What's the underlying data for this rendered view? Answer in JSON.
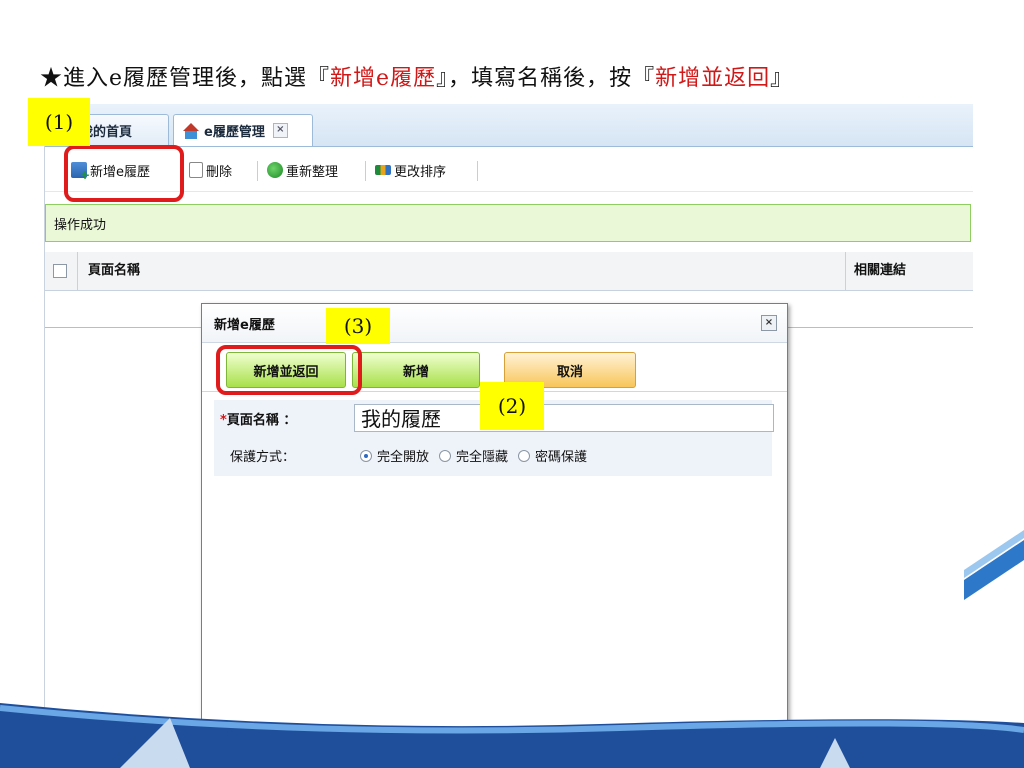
{
  "caption": {
    "star": "★",
    "part1": "進入e履歷管理後，點選『",
    "hl1": "新增e履歷",
    "part2": "』，填寫名稱後，按『",
    "hl2": "新增並返回",
    "part3": "』"
  },
  "tabs": {
    "home": "我的首頁",
    "active": "e履歷管理",
    "close_glyph": "×"
  },
  "toolbar": {
    "add": "新增e履歷",
    "delete": "刪除",
    "refresh": "重新整理",
    "sort": "更改排序"
  },
  "status": {
    "message": "操作成功"
  },
  "grid": {
    "col_name": "頁面名稱",
    "col_link": "相關連結"
  },
  "dialog": {
    "title": "新增e履歷",
    "close_glyph": "×",
    "btn_add_return": "新增並返回",
    "btn_add": "新增",
    "btn_cancel": "取消",
    "field_name_required": "*",
    "field_name_label": "頁面名稱 ：",
    "field_name_value": "我的履歷",
    "protect_label": "保護方式：",
    "protect_options": [
      "完全開放",
      "完全隱藏",
      "密碼保護"
    ],
    "protect_selected": "完全開放"
  },
  "callouts": {
    "c1": "(1)",
    "c2": "(2)",
    "c3": "(3)"
  },
  "colors": {
    "highlight": "#d01818",
    "callout_bg": "#ffff00",
    "redbox": "#e01b1b"
  }
}
